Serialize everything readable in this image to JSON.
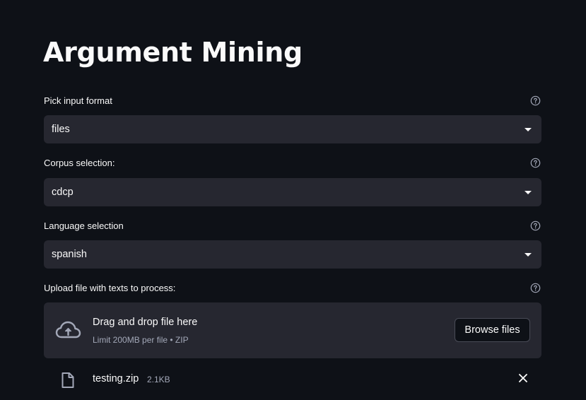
{
  "page": {
    "title": "Argument Mining"
  },
  "fields": {
    "input_format": {
      "label": "Pick input format",
      "value": "files",
      "help_icon": "help-circle-icon"
    },
    "corpus": {
      "label": "Corpus selection:",
      "value": "cdcp",
      "help_icon": "help-circle-icon"
    },
    "language": {
      "label": "Language selection",
      "value": "spanish",
      "help_icon": "help-circle-icon"
    },
    "upload": {
      "label": "Upload file with texts to process:",
      "help_icon": "help-circle-icon",
      "drop_title": "Drag and drop file here",
      "drop_limit": "Limit 200MB per file • ZIP",
      "browse_label": "Browse files",
      "upload_icon": "cloud-upload-icon"
    }
  },
  "uploaded_file": {
    "name": "testing.zip",
    "size": "2.1KB",
    "file_icon": "file-icon",
    "remove_icon": "close-icon"
  },
  "colors": {
    "background": "#0e1117",
    "widget_background": "#262730",
    "text": "#fafafa",
    "muted_text": "#a3a8b8"
  }
}
